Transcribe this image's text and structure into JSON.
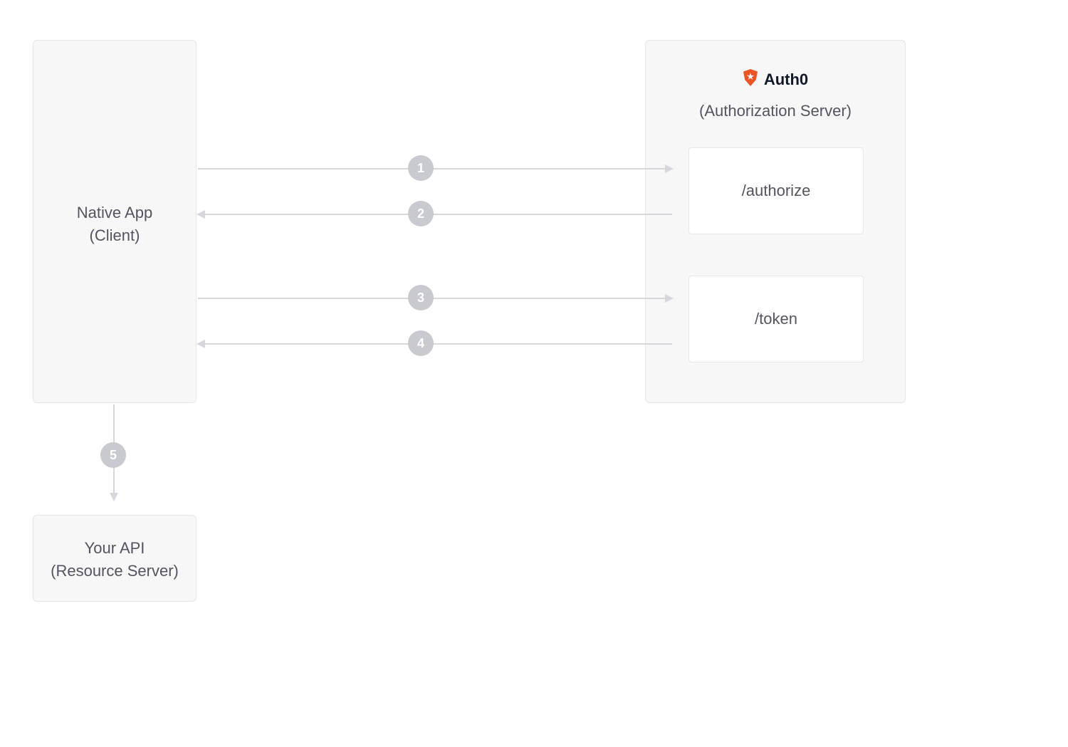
{
  "client": {
    "title": "Native App",
    "subtitle": "(Client)"
  },
  "auth_server": {
    "brand": "Auth0",
    "subtitle": "(Authorization Server)",
    "endpoints": {
      "authorize": "/authorize",
      "token": "/token"
    }
  },
  "resource_server": {
    "title": "Your API",
    "subtitle": "(Resource Server)"
  },
  "steps": {
    "s1": "1",
    "s2": "2",
    "s3": "3",
    "s4": "4",
    "s5": "5"
  },
  "colors": {
    "panel_bg": "#f7f7f8",
    "panel_border": "#e6e6ea",
    "line": "#d6d6dc",
    "badge": "#c9c9d0",
    "text": "#545461",
    "brand_accent": "#eb5424"
  }
}
